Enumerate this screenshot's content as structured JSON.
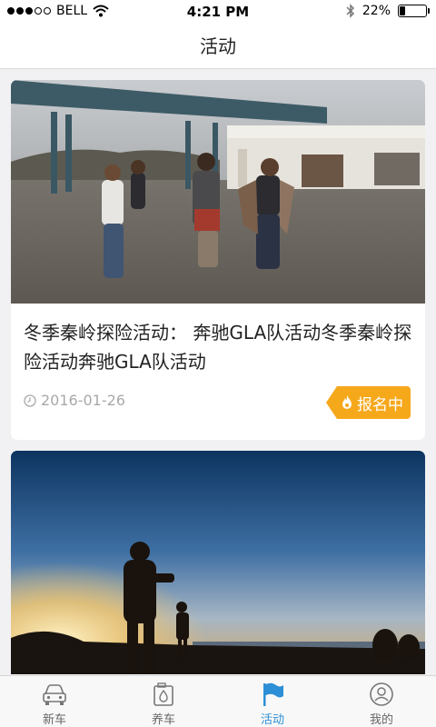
{
  "status_bar": {
    "carrier": "BELL",
    "time": "4:21 PM",
    "battery": "22%",
    "battery_level": 0.22
  },
  "navbar": {
    "title": "活动"
  },
  "cards": [
    {
      "title": "冬季秦岭探险活动：  奔驰GLA队活动冬季秦岭探险活动奔驰GLA队活动",
      "date": "2016-01-26",
      "badge": "报名中"
    },
    {
      "title": ""
    }
  ],
  "tabs": [
    {
      "label": "新车",
      "icon": "car-icon"
    },
    {
      "label": "养车",
      "icon": "oil-can-icon"
    },
    {
      "label": "活动",
      "icon": "flag-icon",
      "active": true
    },
    {
      "label": "我的",
      "icon": "profile-icon"
    }
  ],
  "colors": {
    "accent": "#2d8fd6",
    "badge": "#f6a81b"
  }
}
